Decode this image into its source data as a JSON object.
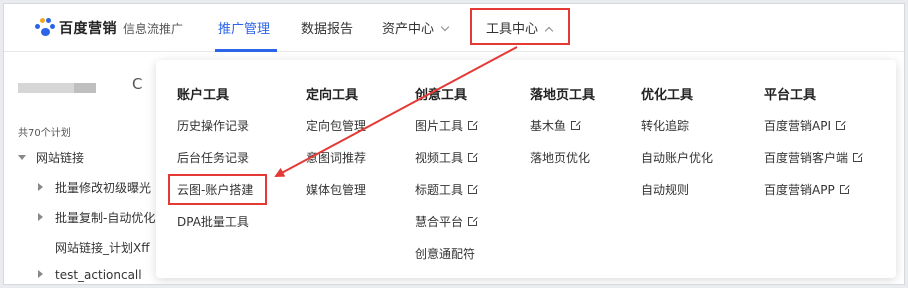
{
  "header": {
    "brand": "百度营销",
    "brand_sub": "信息流推广",
    "nav": [
      {
        "label": "推广管理"
      },
      {
        "label": "数据报告"
      },
      {
        "label": "资产中心"
      },
      {
        "label": "工具中心"
      }
    ]
  },
  "left": {
    "count_label": "共70个计划",
    "tree": [
      {
        "label": "网站链接"
      },
      {
        "label": "批量修改初级曝光"
      },
      {
        "label": "批量复制-自动优化"
      },
      {
        "label": "网站链接_计划Xff"
      },
      {
        "label": "test_actioncall"
      }
    ]
  },
  "dropdown": {
    "columns": [
      {
        "title": "账户工具",
        "items": [
          "历史操作记录",
          "后台任务记录",
          "云图-账户搭建",
          "DPA批量工具"
        ]
      },
      {
        "title": "定向工具",
        "items": [
          "定向包管理",
          "意图词推荐",
          "媒体包管理"
        ]
      },
      {
        "title": "创意工具",
        "items": [
          "图片工具",
          "视频工具",
          "标题工具",
          "慧合平台",
          "创意通配符"
        ]
      },
      {
        "title": "落地页工具",
        "items": [
          "基木鱼",
          "落地页优化"
        ]
      },
      {
        "title": "优化工具",
        "items": [
          "转化追踪",
          "自动账户优化",
          "自动规则"
        ]
      },
      {
        "title": "平台工具",
        "items": [
          "百度营销API",
          "百度营销客户端",
          "百度营销APP"
        ]
      }
    ]
  },
  "colors": {
    "accent": "#2c64e8",
    "highlight_red": "#e53935"
  }
}
